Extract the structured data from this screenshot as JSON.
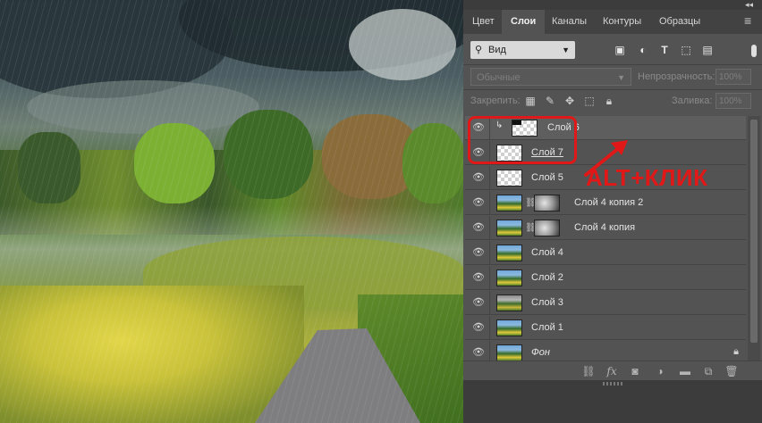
{
  "tabs": [
    "Цвет",
    "Слои",
    "Каналы",
    "Контуры",
    "Образцы"
  ],
  "active_tab": "Слои",
  "filter": {
    "kind": "Вид"
  },
  "blend_mode": "Обычные",
  "opacity": {
    "label": "Непрозрачность:",
    "value": "100%"
  },
  "lock": {
    "label": "Закрепить:"
  },
  "fill": {
    "label": "Заливка:",
    "value": "100%"
  },
  "layers": [
    {
      "name": "Слой 6",
      "clipped": true,
      "thumb": "checker-dark"
    },
    {
      "name": "Слой 7",
      "underline": true,
      "thumb": "checker"
    },
    {
      "name": "Слой 5",
      "thumb": "checker"
    },
    {
      "name": "Слой 4 копия 2",
      "thumb": "landscape",
      "mask": true
    },
    {
      "name": "Слой 4 копия",
      "thumb": "landscape",
      "mask": true
    },
    {
      "name": "Слой 4",
      "thumb": "landscape"
    },
    {
      "name": "Слой 2",
      "thumb": "landscape"
    },
    {
      "name": "Слой 3",
      "thumb": "landscape2"
    },
    {
      "name": "Слой 1",
      "thumb": "landscape"
    },
    {
      "name": "Фон",
      "italic": true,
      "locked": true,
      "thumb": "landscape"
    }
  ],
  "annotation": {
    "text": "ALT+КЛИК",
    "color": "#e01818"
  },
  "bottom_icons": [
    "link-icon",
    "fx-icon",
    "mask-icon",
    "adjustment-icon",
    "folder-icon",
    "new-layer-icon",
    "trash-icon"
  ]
}
